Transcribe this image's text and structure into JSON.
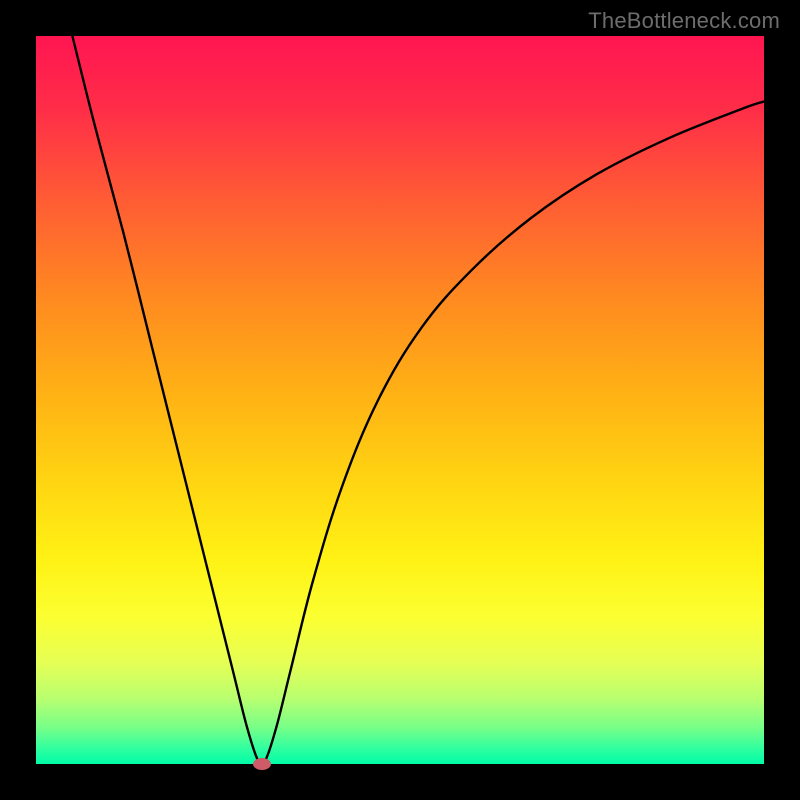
{
  "watermark": "TheBottleneck.com",
  "chart_data": {
    "type": "line",
    "title": "",
    "xlabel": "",
    "ylabel": "",
    "xlim": [
      0,
      100
    ],
    "ylim": [
      0,
      100
    ],
    "grid": false,
    "legend": false,
    "background_gradient": {
      "top": "#ff1551",
      "bottom": "#00fca8"
    },
    "series": [
      {
        "name": "bottleneck-curve",
        "color": "#000000",
        "x": [
          5,
          8,
          12,
          16,
          20,
          24,
          27,
          29,
          30.5,
          31.5,
          33,
          35,
          38,
          42,
          47,
          53,
          60,
          68,
          77,
          87,
          97,
          100
        ],
        "y": [
          100,
          88,
          73,
          57,
          41,
          25,
          13,
          5,
          0.5,
          0.5,
          5,
          13,
          25,
          38,
          50,
          60,
          68,
          75,
          81,
          86,
          90,
          91
        ]
      }
    ],
    "marker": {
      "x": 31,
      "y": 0,
      "color": "#cf5a68"
    },
    "frame_color": "#000000"
  }
}
